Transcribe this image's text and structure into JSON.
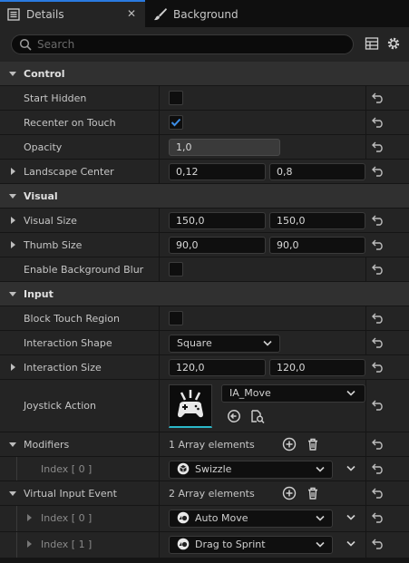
{
  "tabs": [
    {
      "label": "Details",
      "active": true,
      "close": "✕"
    },
    {
      "label": "Background",
      "active": false
    }
  ],
  "search": {
    "placeholder": "Search",
    "value": ""
  },
  "colors": {
    "accent": "#2a7ae0",
    "check": "#3c8ee8",
    "thumb_underline": "#2ab7c8"
  },
  "categories": {
    "control": "Control",
    "visual": "Visual",
    "input": "Input"
  },
  "control": {
    "start_hidden": {
      "label": "Start Hidden",
      "checked": false
    },
    "recenter_on_touch": {
      "label": "Recenter on Touch",
      "checked": true
    },
    "opacity": {
      "label": "Opacity",
      "value": "1,0"
    },
    "landscape_center": {
      "label": "Landscape Center",
      "x": "0,12",
      "y": "0,8"
    }
  },
  "visual": {
    "visual_size": {
      "label": "Visual Size",
      "x": "150,0",
      "y": "150,0"
    },
    "thumb_size": {
      "label": "Thumb Size",
      "x": "90,0",
      "y": "90,0"
    },
    "enable_background_blur": {
      "label": "Enable Background Blur",
      "checked": false
    }
  },
  "input": {
    "block_touch_region": {
      "label": "Block Touch Region",
      "checked": false
    },
    "interaction_shape": {
      "label": "Interaction Shape",
      "value": "Square"
    },
    "interaction_size": {
      "label": "Interaction Size",
      "x": "120,0",
      "y": "120,0"
    },
    "joystick_action": {
      "label": "Joystick Action",
      "value": "IA_Move"
    },
    "modifiers": {
      "label": "Modifiers",
      "count": "1 Array elements",
      "items": [
        {
          "index": "Index [ 0 ]",
          "value": "Swizzle"
        }
      ]
    },
    "virtual_input_event": {
      "label": "Virtual Input Event",
      "count": "2 Array elements",
      "items": [
        {
          "index": "Index [ 0 ]",
          "value": "Auto Move"
        },
        {
          "index": "Index [ 1 ]",
          "value": "Drag to Sprint"
        }
      ]
    }
  }
}
